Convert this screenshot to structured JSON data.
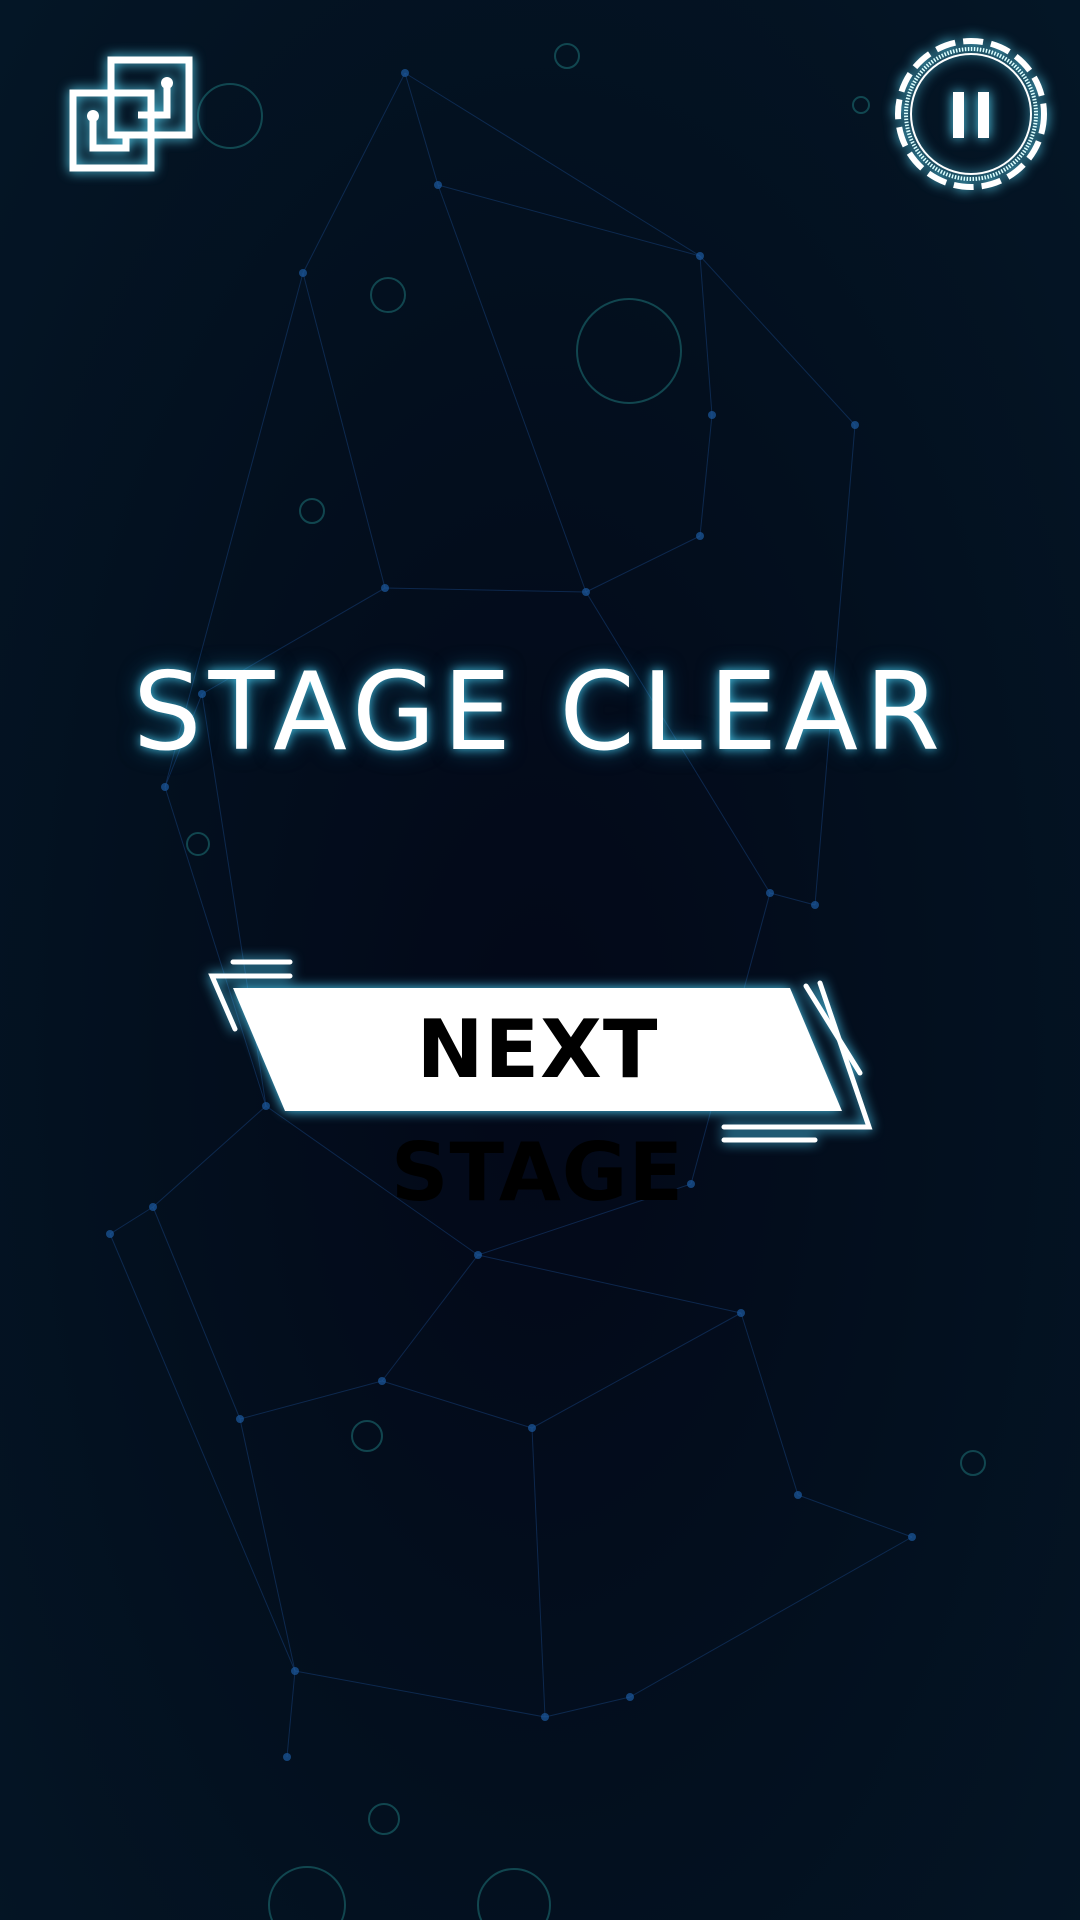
{
  "title": "STAGE CLEAR",
  "next_button": {
    "label": "NEXT STAGE"
  },
  "icons": {
    "menu": "circuit-squares-icon",
    "pause": "pause-icon"
  },
  "colors": {
    "background": "#030a1a",
    "glow": "#50dcff",
    "network": "#1a4a8a",
    "button_fill": "#ffffff",
    "button_text": "#000000"
  }
}
